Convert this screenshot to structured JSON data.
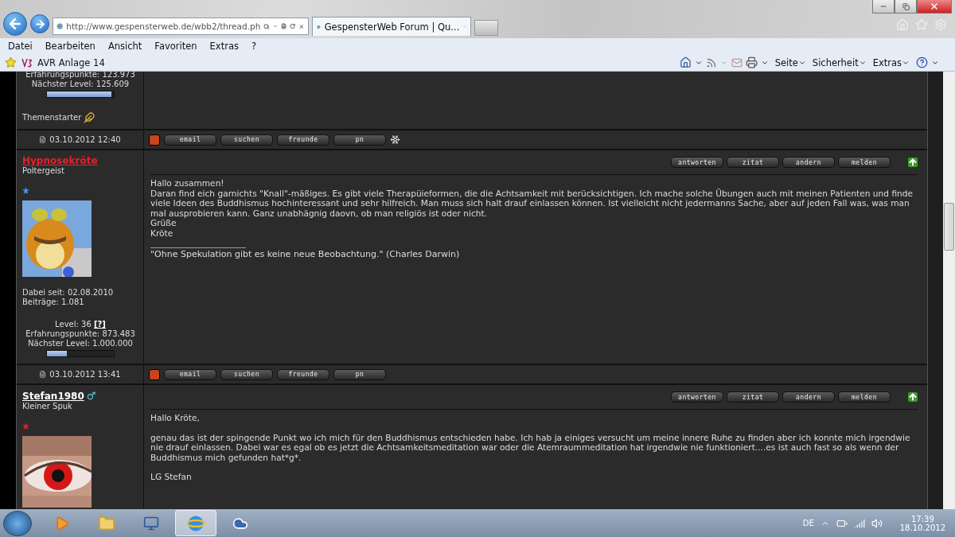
{
  "browser": {
    "url": "http://www.gespensterweb.de/wbb2/thread.ph",
    "tab_title": "GespensterWeb Forum | Qu...",
    "menu": [
      "Datei",
      "Bearbeiten",
      "Ansicht",
      "Favoriten",
      "Extras",
      "?"
    ],
    "favorites": [
      "AVR Anlage 14"
    ],
    "commands": [
      "Seite",
      "Sicherheit",
      "Extras"
    ]
  },
  "posts": [
    {
      "exp": "Erfahrungspunkte: 123.973",
      "next_level": "Nächster Level: 125.609",
      "progress": {
        "level": 0.97
      },
      "starter": "Themenstarter",
      "date": "03.10.2012 12:40",
      "footer_buttons": [
        "email",
        "suchen",
        "freunde",
        "pn"
      ],
      "extra_footer_icon": true
    },
    {
      "author": {
        "name": "Hypnosekröte",
        "color": "#e8202a"
      },
      "rank": "Poltergeist",
      "rank_star": {
        "color": "#3a9af0"
      },
      "avatar": {
        "kind": "picture"
      },
      "joined": "Dabei seit: 02.08.2010",
      "post_count": "Beiträge: 1.081",
      "level_text": "Level: 36",
      "level_help": "[?]",
      "exp": "Erfahrungspunkte: 873.483",
      "next_level": "Nächster Level: 1.000.000",
      "progress": {
        "level": 0.3
      },
      "actions": [
        "antworten",
        "zitat",
        "andern",
        "melden"
      ],
      "body": [
        [
          "Hallo zusammen!",
          "Daran find eich garnichts \"Knall\"-mäßiges. Es gibt viele Therapüieformen, die die Achtsamkeit mit berücksichtigen. Ich mache solche Übungen auch mit meinen Patienten und finde viele Ideen des Buddhismus hochinteressant und sehr hilfreich. Man muss sich halt drauf einlassen können. Ist vielleicht nicht jedermanns Sache, aber auf jeden Fall was, was man mal ausprobieren kann. Ganz unabhägnig daovn, ob man religiös ist oder nicht.",
          "Grüße",
          "Kröte"
        ]
      ],
      "signature": "\"Ohne Spekulation gibt es keine neue Beobachtung.\" (Charles Darwin)",
      "date": "03.10.2012 13:41",
      "footer_buttons": [
        "email",
        "suchen",
        "freunde",
        "pn"
      ],
      "extra_footer_icon": false
    },
    {
      "author": {
        "name": "Stefan1980",
        "color": "#ffffff"
      },
      "gender_sign": "♂",
      "rank": "Kleiner Spuk",
      "rank_star": {
        "color": "#e02020"
      },
      "avatar": {
        "kind": "picture"
      },
      "actions": [
        "antworten",
        "zitat",
        "andern",
        "melden"
      ],
      "body": [
        [
          "Hallo Kröte,"
        ],
        [
          "genau das ist der spingende Punkt wo ich mich für den Buddhismus entschieden habe. Ich hab ja einiges versucht um meine innere Ruhe zu finden aber ich konnte mich irgendwie nie drauf einlassen. Dabei war es egal ob es jetzt die Achtsamkeitsmeditation war oder die Atemraummeditation hat irgendwie nie funktioniert....es ist auch fast so als wenn der Buddhismus mich gefunden hat*g*."
        ],
        [
          "LG Stefan"
        ]
      ]
    }
  ],
  "taskbar": {
    "language": "DE",
    "time": "17:39",
    "date": "18.10.2012"
  }
}
